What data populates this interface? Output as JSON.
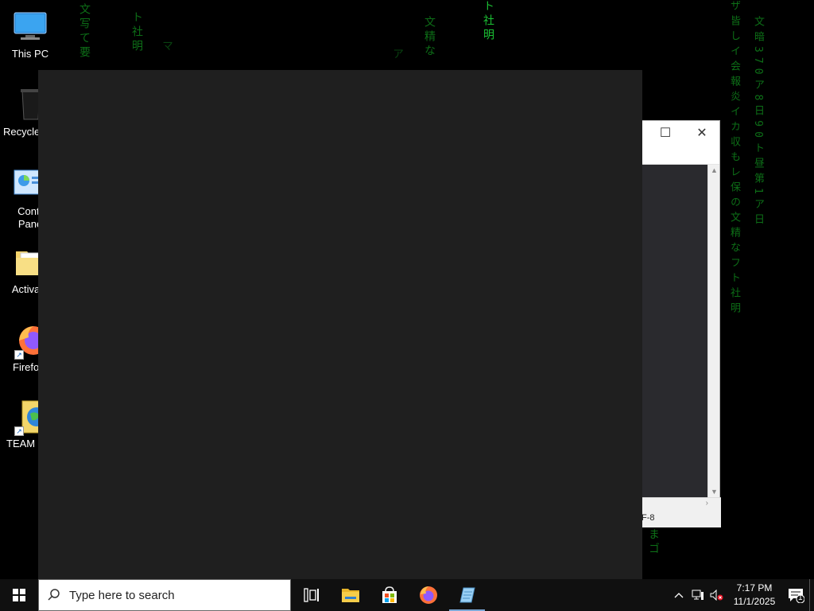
{
  "desktop": {
    "matrix_text": {
      "col1": "文写て要",
      "col2": "ト社明",
      "col3": "マ",
      "col4": "文精な",
      "col5": "ト社明",
      "col6": "ア",
      "col7": "ザ皆しイ会報炎イカ収もレ保の文精なフト社明",
      "col8": "文暗370ア8日90ト昼第1ア日",
      "col9": "まゴ"
    },
    "icons": [
      {
        "label": "This PC"
      },
      {
        "label": "Recycle"
      },
      {
        "label": "Contr\nPane"
      },
      {
        "label": "Activato"
      },
      {
        "label": "Firefo"
      },
      {
        "label": "TEAM"
      }
    ]
  },
  "background_window": {
    "maximize_glyph": "☐",
    "close_glyph": "✕",
    "status_encoding": "F-8",
    "editor_bg": "#2a2a2e"
  },
  "blank_window": {
    "bg": "#1f1f1f"
  },
  "taskbar": {
    "search_placeholder": "Type here to search",
    "pinned": [
      {
        "name": "task-view"
      },
      {
        "name": "file-explorer"
      },
      {
        "name": "microsoft-store"
      },
      {
        "name": "firefox"
      },
      {
        "name": "notepad"
      }
    ],
    "clock": {
      "time": "7:17 PM",
      "date": "11/1/2025"
    },
    "notification_count": "1"
  }
}
